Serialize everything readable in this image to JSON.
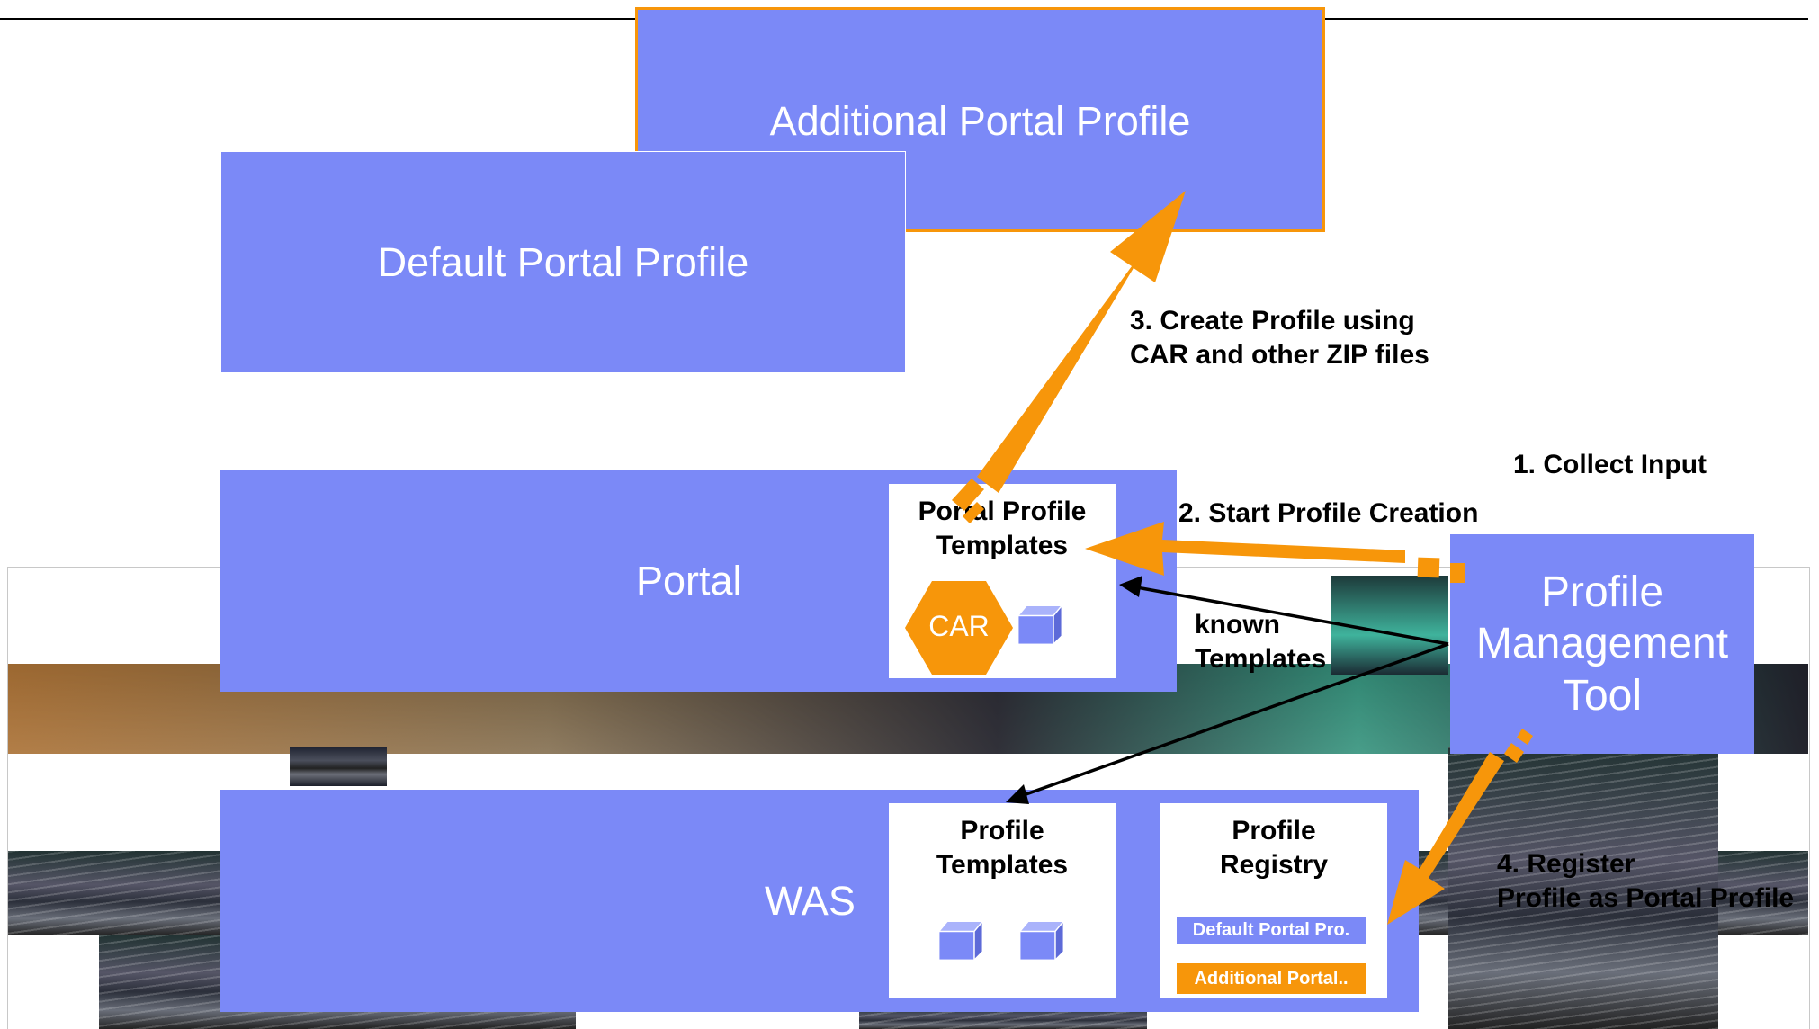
{
  "boxes": {
    "additional_profile": "Additional Portal Profile",
    "default_profile": "Default Portal Profile",
    "portal": "Portal",
    "was": "WAS",
    "pmt": "Profile Management Tool"
  },
  "portal_templates": {
    "title": "Portal Profile Templates",
    "car_label": "CAR"
  },
  "was_templates": {
    "title": "Profile Templates"
  },
  "registry": {
    "title": "Profile Registry",
    "entries": [
      "Default Portal Pro.",
      "Additional Portal.."
    ]
  },
  "steps": {
    "step1": "1. Collect Input",
    "step2": "2. Start Profile Creation",
    "step3_line1": "3. Create Profile using",
    "step3_line2": "CAR and other ZIP files",
    "step4_line1": "4. Register",
    "step4_line2": "Profile as Portal Profile",
    "known_line1": "known",
    "known_line2": "Templates"
  },
  "colors": {
    "box_fill": "#7b89f7",
    "accent_orange": "#f7960a",
    "arrow_black": "#000000"
  }
}
